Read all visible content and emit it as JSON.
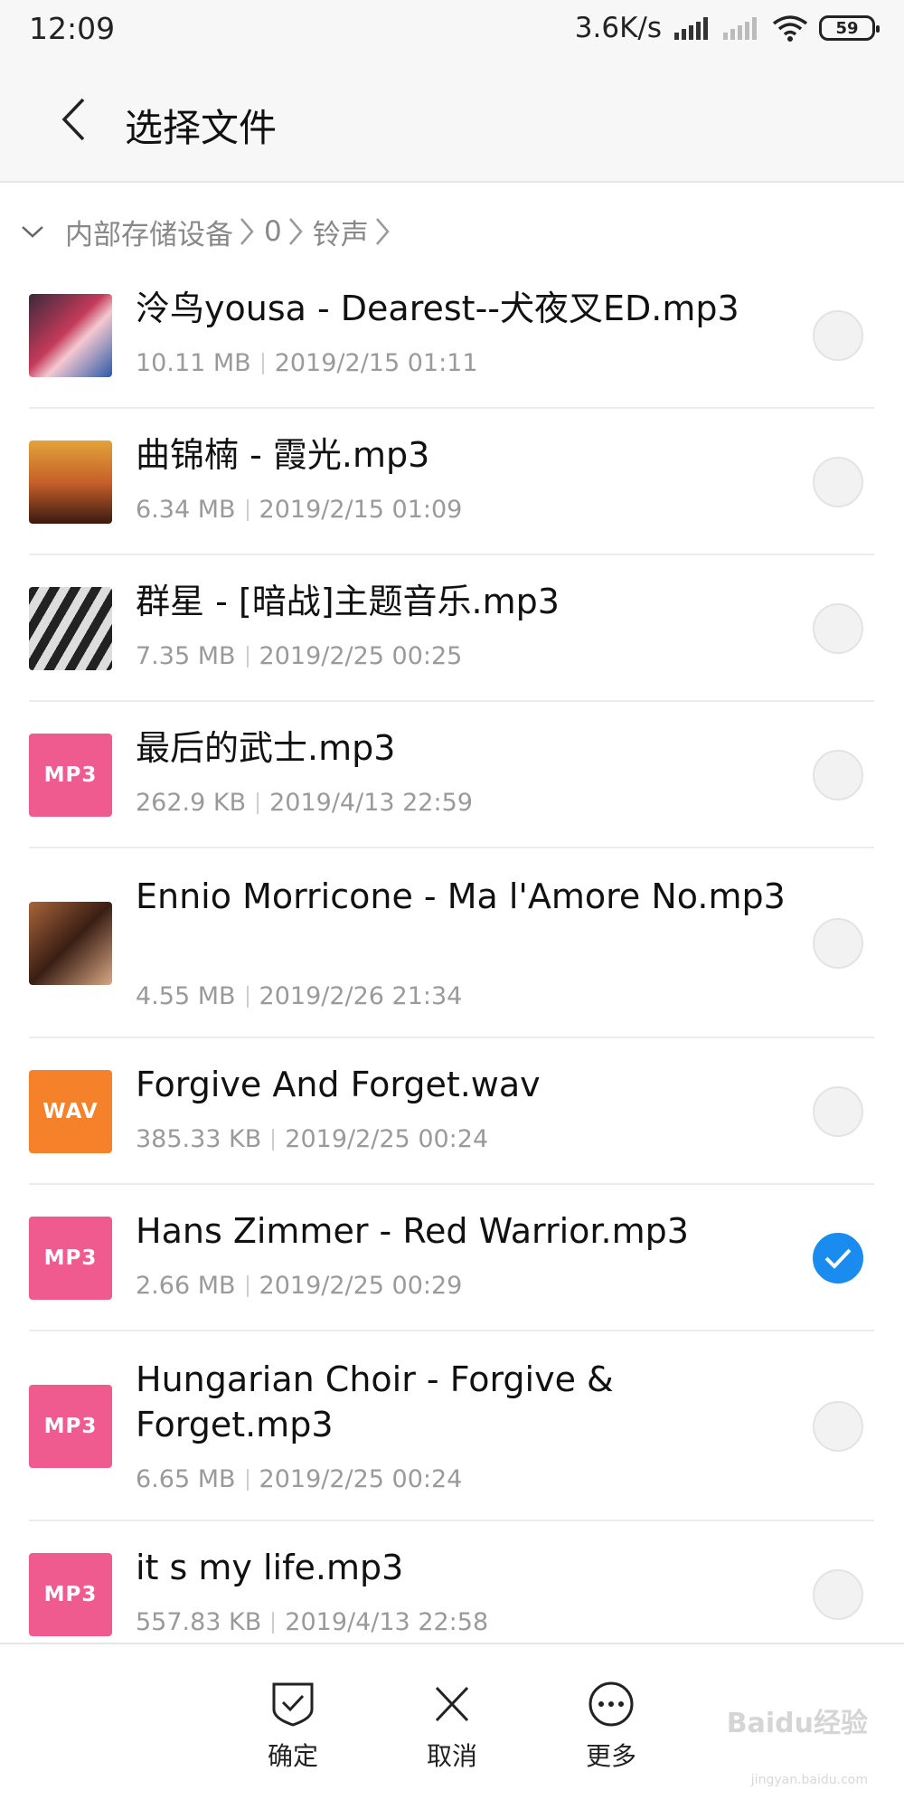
{
  "status_bar": {
    "time": "12:09",
    "speed": "3.6K/s",
    "battery": "59"
  },
  "header": {
    "title": "选择文件",
    "back_icon": "back-arrow-icon"
  },
  "breadcrumb": {
    "items": [
      "内部存储设备",
      "0",
      "铃声"
    ]
  },
  "files": [
    {
      "name": "泠鸟yousa - Dearest--犬夜叉ED.mp3",
      "size": "10.11 MB",
      "date": "2019/2/15 01:11",
      "thumb": "image",
      "checked": false
    },
    {
      "name": "曲锦楠 - 霞光.mp3",
      "size": "6.34 MB",
      "date": "2019/2/15 01:09",
      "thumb": "image",
      "checked": false
    },
    {
      "name": "群星 - [暗战]主题音乐.mp3",
      "size": "7.35 MB",
      "date": "2019/2/25 00:25",
      "thumb": "image",
      "checked": false
    },
    {
      "name": "最后的武士.mp3",
      "size": "262.9 KB",
      "date": "2019/4/13 22:59",
      "thumb": "MP3",
      "checked": false
    },
    {
      "name": "Ennio Morricone - Ma l'Amore No.mp3",
      "size": "4.55 MB",
      "date": "2019/2/26 21:34",
      "thumb": "image",
      "checked": false
    },
    {
      "name": "Forgive And Forget.wav",
      "size": "385.33 KB",
      "date": "2019/2/25 00:24",
      "thumb": "WAV",
      "checked": false
    },
    {
      "name": "Hans Zimmer - Red Warrior.mp3",
      "size": "2.66 MB",
      "date": "2019/2/25 00:29",
      "thumb": "MP3",
      "checked": true
    },
    {
      "name": "Hungarian Choir - Forgive & Forget.mp3",
      "size": "6.65 MB",
      "date": "2019/2/25 00:24",
      "thumb": "MP3",
      "checked": false
    },
    {
      "name": "it s my life.mp3",
      "size": "557.83 KB",
      "date": "2019/4/13 22:58",
      "thumb": "MP3",
      "checked": false
    }
  ],
  "bottom_bar": {
    "confirm": "确定",
    "cancel": "取消",
    "more": "更多"
  },
  "watermark": {
    "brand": "Baidu经验",
    "url": "jingyan.baidu.com"
  },
  "colors": {
    "accent": "#1a8cf0",
    "mp3": "#ef5a8f",
    "wav": "#f5822a"
  }
}
